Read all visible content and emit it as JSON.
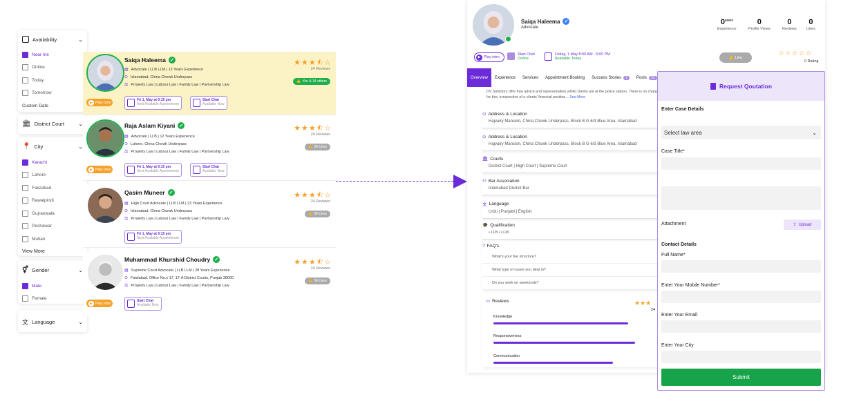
{
  "filters": {
    "availability": {
      "label": "Availability",
      "options": [
        "Near me",
        "Online",
        "Today",
        "Tomorrow"
      ],
      "custom": "Custom Date"
    },
    "district": {
      "label": "District Court"
    },
    "city": {
      "label": "City",
      "options": [
        "Karachi",
        "Lahore",
        "Faislabad",
        "Rawalpindi",
        "Gujranwala",
        "Peshawar",
        "Multan"
      ],
      "view_more": "View More"
    },
    "gender": {
      "label": "Gender",
      "options": [
        "Male",
        "Female"
      ]
    },
    "language": {
      "label": "Language"
    }
  },
  "lawyers": [
    {
      "name": "Saiqa Haleema",
      "title": "Advocate | LLB LLM | 12 Years Experience",
      "location": "Islamabad, China Chowk Underpass",
      "practice": "Property Law  |  Labour Law  |  Family Law  |  Partnership Law",
      "reviews": "24 Reviews",
      "likes": "You & 34 others",
      "appt_title": "Fri 1, May at 9:15 pm",
      "appt_sub": "Next Available Appointment",
      "chat_title": "Start Chat",
      "chat_sub": "Available Now",
      "play": "Play intro"
    },
    {
      "name": "Raja Aslam Kiyani",
      "title": "Advocate | LLB | 12 Years Experience",
      "location": "Lahore, China Chowk Underpass",
      "practice": "Property Law  |  Labour Law  |  Family Law  |  Partnership Law",
      "reviews": "24 Reviews",
      "likes": "34 Likes",
      "appt_title": "Fri 1, May at 9:15 pm",
      "appt_sub": "Next Available Appointment",
      "chat_title": "Start Chat",
      "chat_sub": "Available Now",
      "play": "Play intro"
    },
    {
      "name": "Qasim Muneer",
      "title": "High Court Advocate | LLB LLM | 22 Years Experience",
      "location": "Islamabad, China Chowk Underpass",
      "practice": "Property Law  |  Labour Law  |  Family Law  |  Partnership Law",
      "reviews": "24 Reviews",
      "likes": "34 Likes",
      "appt_title": "Fri 1, May at 9:15 pm",
      "appt_sub": "Next Available Appointment"
    },
    {
      "name": "Muhammad Khurshid Choudry",
      "title": "Supreme Court Advocate | LLB LLM | 28 Years Experience",
      "location": "Faislabad, Office No.s 17, 17-A District Courts, Punjab 38000",
      "practice": "Property Law  |  Labour Law  |  Family Law  |  Partnership Law",
      "reviews": "24 Reviews",
      "likes": "34 Likes",
      "chat_title": "Start Chat",
      "chat_sub": "Available Now",
      "play": "Play intro"
    }
  ],
  "profile": {
    "name": "Saiqa Haleema",
    "role": "Advocate",
    "stats": [
      {
        "value": "0",
        "sup": "years",
        "label": "Experience"
      },
      {
        "value": "0",
        "label": "Profile Views"
      },
      {
        "value": "0",
        "label": "Reviews"
      },
      {
        "value": "0",
        "label": "Likes"
      }
    ],
    "play": "Play intro",
    "chat_title": "Start Chat",
    "chat_sub": "Online",
    "time_title": "Friday, 1 May  8:00 AM - 5:00 PM",
    "time_sub": "Available Today",
    "like_btn": "Like",
    "rating": "0  Rating",
    "tabs": [
      "Overview",
      "Experience",
      "Services",
      "Appointment Booking",
      "Success Stories",
      "Posts"
    ],
    "tab_badges": {
      "success": "1",
      "posts": "23"
    },
    "about": "DV Solicitors offer free advice and representation whilst clients are at the police station. There is no charge for this, irrespective of a clients' financial position...",
    "see_more": "See More",
    "sections": [
      {
        "title": "Address & Location",
        "value": "Hajvairy Mansion, China Chowk Underpass, Block B G 6/3 Blue Area, Islamabad"
      },
      {
        "title": "Address & Location",
        "value": "Hajvairy Mansion, China Chowk Underpass, Block B G 6/3 Blue Area, Islamabad"
      },
      {
        "title": "Courts",
        "value": "District Court | High Court | Supreme Court"
      },
      {
        "title": "Bar Association",
        "value": "Islamabad District Bar"
      },
      {
        "title": "Language",
        "value": "Urdu  |  Punjabi  |  English"
      },
      {
        "title": "Qualification",
        "value": "• LLB      • LLM"
      }
    ],
    "faq_title": "FAQ's",
    "faqs": [
      "What's your fee structure?",
      "What type of cases you deal in?",
      "Do you work on weekends?"
    ],
    "reviews_title": "Reviews",
    "reviews_count": "24",
    "review_bars": [
      {
        "label": "Knowledge",
        "fraction": 0.78
      },
      {
        "label": "Responsiveness",
        "fraction": 0.82
      },
      {
        "label": "Communication",
        "fraction": 0.69
      }
    ]
  },
  "quote": {
    "header": "Request Qoutation",
    "case_section": "Enter Case Details",
    "law_area": "Select law area",
    "case_title": "Case Title*",
    "attachment": "Attachment",
    "upload": "Upload",
    "contact_section": "Contact Details",
    "full_name": "Full Name*",
    "mobile": "Enter Your Mobile Number*",
    "email": "Enter Your Email",
    "city": "Enter Your City",
    "submit": "Submit"
  },
  "colors": {
    "accent": "#6c2bd9",
    "highlight": "#fbf3c6",
    "star": "#f4a12a",
    "verified": "#1fae4b",
    "submit": "#16a34a"
  }
}
